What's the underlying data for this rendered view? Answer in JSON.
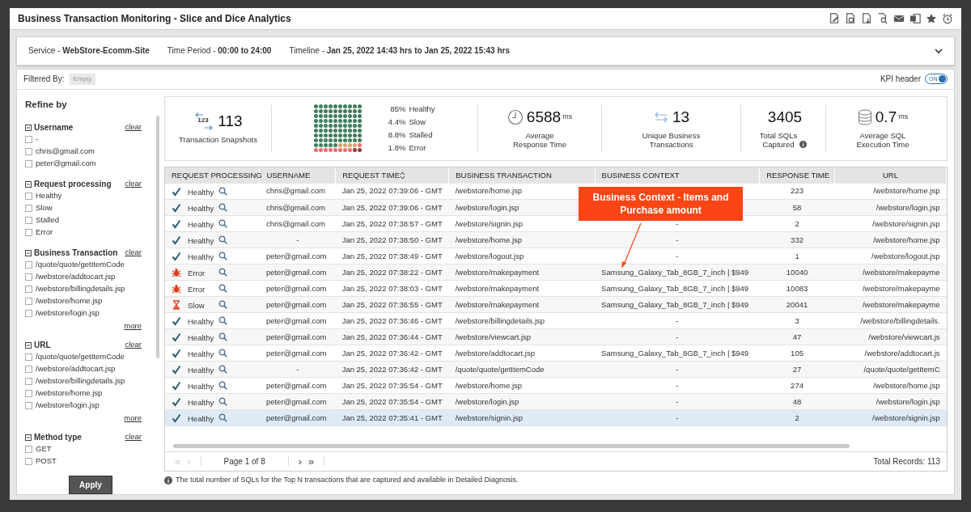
{
  "window": {
    "title": "Business Transaction Monitoring - Slice and Dice Analytics"
  },
  "info_bar": [
    {
      "label": "Service - ",
      "value": "WebStore-Ecomm-Site"
    },
    {
      "label": "Time Period - ",
      "value": "00:00 to 24:00"
    },
    {
      "label": "Timeline - ",
      "value": "Jan 25, 2022 14:43 hrs to Jan 25, 2022 15:43 hrs"
    }
  ],
  "filter": {
    "label": "Filtered By:",
    "value": "Empty"
  },
  "kpi_header": {
    "label": "KPI header",
    "toggle_text": "ON",
    "on": true
  },
  "sidebar": {
    "title": "Refine by",
    "groups": [
      {
        "title": "Username",
        "expanded": true,
        "clear": "clear",
        "items": [
          {
            "label": "-",
            "checked": false
          },
          {
            "label": "chris@gmail.com",
            "checked": false
          },
          {
            "label": "peter@gmail.com",
            "checked": false
          }
        ]
      },
      {
        "title": "Request processing",
        "expanded": true,
        "clear": "clear",
        "items": [
          {
            "label": "Healthy",
            "checked": false
          },
          {
            "label": "Slow",
            "checked": false
          },
          {
            "label": "Stalled",
            "checked": false
          },
          {
            "label": "Error",
            "checked": false
          }
        ]
      },
      {
        "title": "Business Transaction",
        "expanded": true,
        "clear": "clear",
        "items": [
          {
            "label": "/quote/quote/getItemCode",
            "checked": false
          },
          {
            "label": "/webstore/addtocart.jsp",
            "checked": false
          },
          {
            "label": "/webstore/billingdetails.jsp",
            "checked": false
          },
          {
            "label": "/webstore/home.jsp",
            "checked": false
          },
          {
            "label": "/webstore/login.jsp",
            "checked": false
          }
        ],
        "more": "more"
      },
      {
        "title": "URL",
        "expanded": true,
        "clear": "clear",
        "items": [
          {
            "label": "/quote/quote/getItemCode",
            "checked": false
          },
          {
            "label": "/webstore/addtocart.jsp",
            "checked": false
          },
          {
            "label": "/webstore/billingdetails.jsp",
            "checked": false
          },
          {
            "label": "/webstore/home.jsp",
            "checked": false
          },
          {
            "label": "/webstore/login.jsp",
            "checked": false
          }
        ],
        "more": "more"
      },
      {
        "title": "Method type",
        "expanded": true,
        "clear": "clear",
        "items": [
          {
            "label": "GET",
            "checked": false
          },
          {
            "label": "POST",
            "checked": false
          }
        ]
      }
    ],
    "apply": "Apply"
  },
  "kpis": [
    {
      "kind": "snapshots",
      "icon_text": "123",
      "value": "113",
      "lines": [
        "Transaction Snapshots"
      ]
    },
    {
      "kind": "waffle",
      "legend": [
        {
          "pct": "85%",
          "label": "Healthy",
          "color": "#3f7f5c"
        },
        {
          "pct": "4.4%",
          "label": "Slow",
          "color": "#d9a06a"
        },
        {
          "pct": "8.8%",
          "label": "Stalled",
          "color": "#ef6b6b"
        },
        {
          "pct": "1.8%",
          "label": "Error",
          "color": "#9a3a32"
        }
      ]
    },
    {
      "kind": "clock",
      "value": "6588",
      "unit": "ms",
      "lines": [
        "Average",
        "Response Time"
      ]
    },
    {
      "kind": "arrows",
      "value": "13",
      "lines": [
        "Unique Business",
        "Transactions"
      ]
    },
    {
      "kind": "plain",
      "value": "3405",
      "lines": [
        "Total SQLs",
        "Captured"
      ],
      "info": true
    },
    {
      "kind": "database",
      "value": "0.7",
      "unit": "ms",
      "lines": [
        "Average SQL",
        "Execution Time"
      ]
    }
  ],
  "table": {
    "columns": [
      {
        "label": "REQUEST PROCESSING"
      },
      {
        "label": "USERNAME"
      },
      {
        "label": "REQUEST TIME",
        "sortable": true
      },
      {
        "label": "BUSINESS TRANSACTION"
      },
      {
        "label": "BUSINESS CONTEXT"
      },
      {
        "label": "RESPONSE TIME"
      },
      {
        "label": "URL"
      }
    ],
    "rows": [
      {
        "kind": "healthy",
        "status_text": "Healthy",
        "username": "chris@gmail.com",
        "time": "Jan 25, 2022 07:39:06 - GMT",
        "transaction": "/webstore/home.jsp",
        "response": "223",
        "url": "/webstore/home.jsp",
        "selected": false
      },
      {
        "kind": "healthy",
        "status_text": "Healthy",
        "username": "chris@gmail.com",
        "time": "Jan 25, 2022 07:39:06 - GMT",
        "transaction": "/webstore/login.jsp",
        "response": "58",
        "url": "/webstore/login.jsp",
        "selected": false
      },
      {
        "kind": "healthy",
        "status_text": "Healthy",
        "username": "chris@gmail.com",
        "time": "Jan 25, 2022 07:38:57 - GMT",
        "transaction": "/webstore/signin.jsp",
        "context": "-",
        "response": "2",
        "url": "/webstore/signin.jsp",
        "selected": false
      },
      {
        "kind": "healthy",
        "status_text": "Healthy",
        "username": "-",
        "time": "Jan 25, 2022 07:38:50 - GMT",
        "transaction": "/webstore/home.jsp",
        "context": "-",
        "response": "332",
        "url": "/webstore/home.jsp",
        "selected": false
      },
      {
        "kind": "healthy",
        "status_text": "Healthy",
        "username": "peter@gmail.com",
        "time": "Jan 25, 2022 07:38:49 - GMT",
        "transaction": "/webstore/logout.jsp",
        "context": "-",
        "response": "1",
        "url": "/webstore/logout.jsp",
        "selected": false
      },
      {
        "kind": "error",
        "status_text": "Error",
        "username": "peter@gmail.com",
        "time": "Jan 25, 2022 07:38:22 - GMT",
        "transaction": "/webstore/makepayment",
        "context": "Samsung_Galaxy_Tab_8GB_7_inch | $949",
        "response": "10040",
        "url": "/webstore/makepayme",
        "selected": false
      },
      {
        "kind": "error",
        "status_text": "Error",
        "username": "peter@gmail.com",
        "time": "Jan 25, 2022 07:38:03 - GMT",
        "transaction": "/webstore/makepayment",
        "context": "Samsung_Galaxy_Tab_8GB_7_inch | $949",
        "response": "10083",
        "url": "/webstore/makepayme",
        "selected": false
      },
      {
        "kind": "slow",
        "status_text": "Slow",
        "username": "peter@gmail.com",
        "time": "Jan 25, 2022 07:36:55 - GMT",
        "transaction": "/webstore/makepayment",
        "context": "Samsung_Galaxy_Tab_8GB_7_inch | $949",
        "response": "20041",
        "url": "/webstore/makepayme",
        "selected": false
      },
      {
        "kind": "healthy",
        "status_text": "Healthy",
        "username": "peter@gmail.com",
        "time": "Jan 25, 2022 07:36:46 - GMT",
        "transaction": "/webstore/billingdetails.jsp",
        "context": "-",
        "response": "3",
        "url": "/webstore/billingdetails.",
        "selected": false
      },
      {
        "kind": "healthy",
        "status_text": "Healthy",
        "username": "peter@gmail.com",
        "time": "Jan 25, 2022 07:36:44 - GMT",
        "transaction": "/webstore/viewcart.jsp",
        "context": "-",
        "response": "47",
        "url": "/webstore/viewcart.js",
        "selected": false
      },
      {
        "kind": "healthy",
        "status_text": "Healthy",
        "username": "peter@gmail.com",
        "time": "Jan 25, 2022 07:36:42 - GMT",
        "transaction": "/webstore/addtocart.jsp",
        "context": "Samsung_Galaxy_Tab_8GB_7_inch | $949",
        "response": "105",
        "url": "/webstore/addtocart.js",
        "selected": false
      },
      {
        "kind": "healthy",
        "status_text": "Healthy",
        "username": "-",
        "time": "Jan 25, 2022 07:36:42 - GMT",
        "transaction": "/quote/quote/getItemCode",
        "context": "-",
        "response": "27",
        "url": "/quote/quote/getItemC",
        "selected": false
      },
      {
        "kind": "healthy",
        "status_text": "Healthy",
        "username": "peter@gmail.com",
        "time": "Jan 25, 2022 07:35:54 - GMT",
        "transaction": "/webstore/home.jsp",
        "context": "-",
        "response": "274",
        "url": "/webstore/home.jsp",
        "selected": false
      },
      {
        "kind": "healthy",
        "status_text": "Healthy",
        "username": "peter@gmail.com",
        "time": "Jan 25, 2022 07:35:54 - GMT",
        "transaction": "/webstore/login.jsp",
        "context": "-",
        "response": "48",
        "url": "/webstore/login.jsp",
        "selected": false
      },
      {
        "kind": "healthy",
        "status_text": "Healthy",
        "username": "peter@gmail.com",
        "time": "Jan 25, 2022 07:35:41 - GMT",
        "transaction": "/webstore/signin.jsp",
        "context": "-",
        "response": "2",
        "url": "/webstore/signin.jsp",
        "selected": true
      }
    ]
  },
  "callout": {
    "text": "Business Context - Items and Purchase amount"
  },
  "pager": {
    "nav": [
      {
        "symbol": "«",
        "disabled": true
      },
      {
        "symbol": "‹",
        "disabled": true
      },
      {
        "symbol": "›",
        "disabled": false
      },
      {
        "symbol": "»",
        "disabled": false
      }
    ],
    "page": "Page 1 of 8",
    "total": "Total Records: 113"
  },
  "note": "The total number of SQLs for the Top N transactions that are captured and available in Detailed Diagnosis."
}
